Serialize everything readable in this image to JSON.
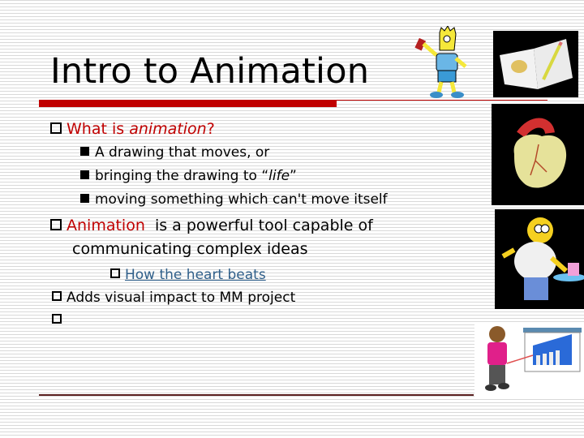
{
  "slide": {
    "title": "Intro to Animation",
    "accent_color": "#c00000",
    "bullets": [
      {
        "parts": [
          "What is ",
          "animation",
          "?"
        ],
        "sub": [
          {
            "text": "A drawing that moves, or"
          },
          {
            "prefix": "bringing the drawing to “",
            "italic": "life",
            "suffix": "”"
          },
          {
            "text": "moving something which can't move itself"
          }
        ]
      },
      {
        "highlight": "Animation",
        "line1_rest": "  is a powerful tool capable of",
        "line2": "communicating complex ideas",
        "link": "How the heart beats"
      },
      {
        "text": "Adds visual impact to MM project"
      },
      {
        "text": ""
      }
    ],
    "images": [
      {
        "name": "bart-simpson-spray-can",
        "alt": "Cartoon boy with spray can"
      },
      {
        "name": "open-book-with-pencil",
        "alt": "Open book with pencil"
      },
      {
        "name": "animated-heart",
        "alt": "3D beating heart"
      },
      {
        "name": "homer-simpson-with-cake",
        "alt": "Cartoon man carrying a cake"
      },
      {
        "name": "presenter-with-chart",
        "alt": "Presenter pointing at bar chart"
      }
    ]
  }
}
